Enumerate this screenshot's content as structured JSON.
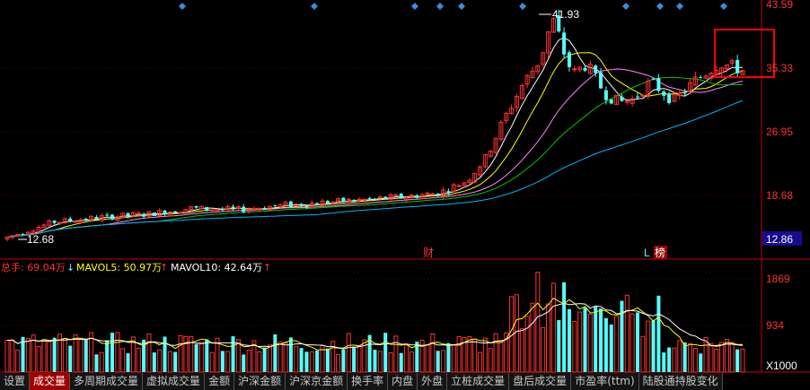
{
  "price_axis": {
    "labels": [
      "43.59",
      "35.33",
      "26.95",
      "18.68"
    ],
    "values": [
      43.59,
      35.33,
      26.95,
      18.68
    ],
    "current_price": "12.86"
  },
  "annotations": {
    "high_label": "41.93",
    "low_label": "12.68",
    "event_cai": "财",
    "event_L": "L",
    "event_bang": "榜"
  },
  "volume_header": {
    "total": "总手: 69.04万",
    "total_arrow": "↓",
    "mavol5": "MAVOL5: 50.97万",
    "mavol5_arrow": "↑",
    "mavol10": "MAVOL10: 42.64万",
    "mavol10_arrow": "↑"
  },
  "volume_axis": {
    "labels": [
      "1869",
      "934"
    ],
    "unit": "X1000"
  },
  "tabs": [
    {
      "label": "设置",
      "active": false
    },
    {
      "label": "成交量",
      "active": true
    },
    {
      "label": "多周期成交量",
      "active": false
    },
    {
      "label": "虚拟成交量",
      "active": false
    },
    {
      "label": "金额",
      "active": false
    },
    {
      "label": "沪深金额",
      "active": false
    },
    {
      "label": "沪深京金额",
      "active": false
    },
    {
      "label": "换手率",
      "active": false
    },
    {
      "label": "内盘",
      "active": false
    },
    {
      "label": "外盘",
      "active": false
    },
    {
      "label": "立桩成交量",
      "active": false
    },
    {
      "label": "盘后成交量",
      "active": false
    },
    {
      "label": "市盈率(ttm)",
      "active": false
    },
    {
      "label": "陆股通持股变化",
      "active": false
    }
  ],
  "colors": {
    "up": "#ff3232",
    "down": "#54ffff",
    "ma5": "#ffffff",
    "ma10": "#ffff00",
    "ma20": "#ff80ff",
    "ma30": "#00c800",
    "ma60": "#00b4ff",
    "axis_red": "#c80000",
    "highlight": "#ff0000",
    "diamond": "#3c8cdc"
  },
  "chart_data": {
    "type": "candlestick",
    "ylim": [
      12.0,
      43.59
    ],
    "high": 41.93,
    "low": 12.68,
    "last": 12.86,
    "volume_ylim": [
      0,
      2100
    ],
    "volume_unit": "X1000"
  }
}
